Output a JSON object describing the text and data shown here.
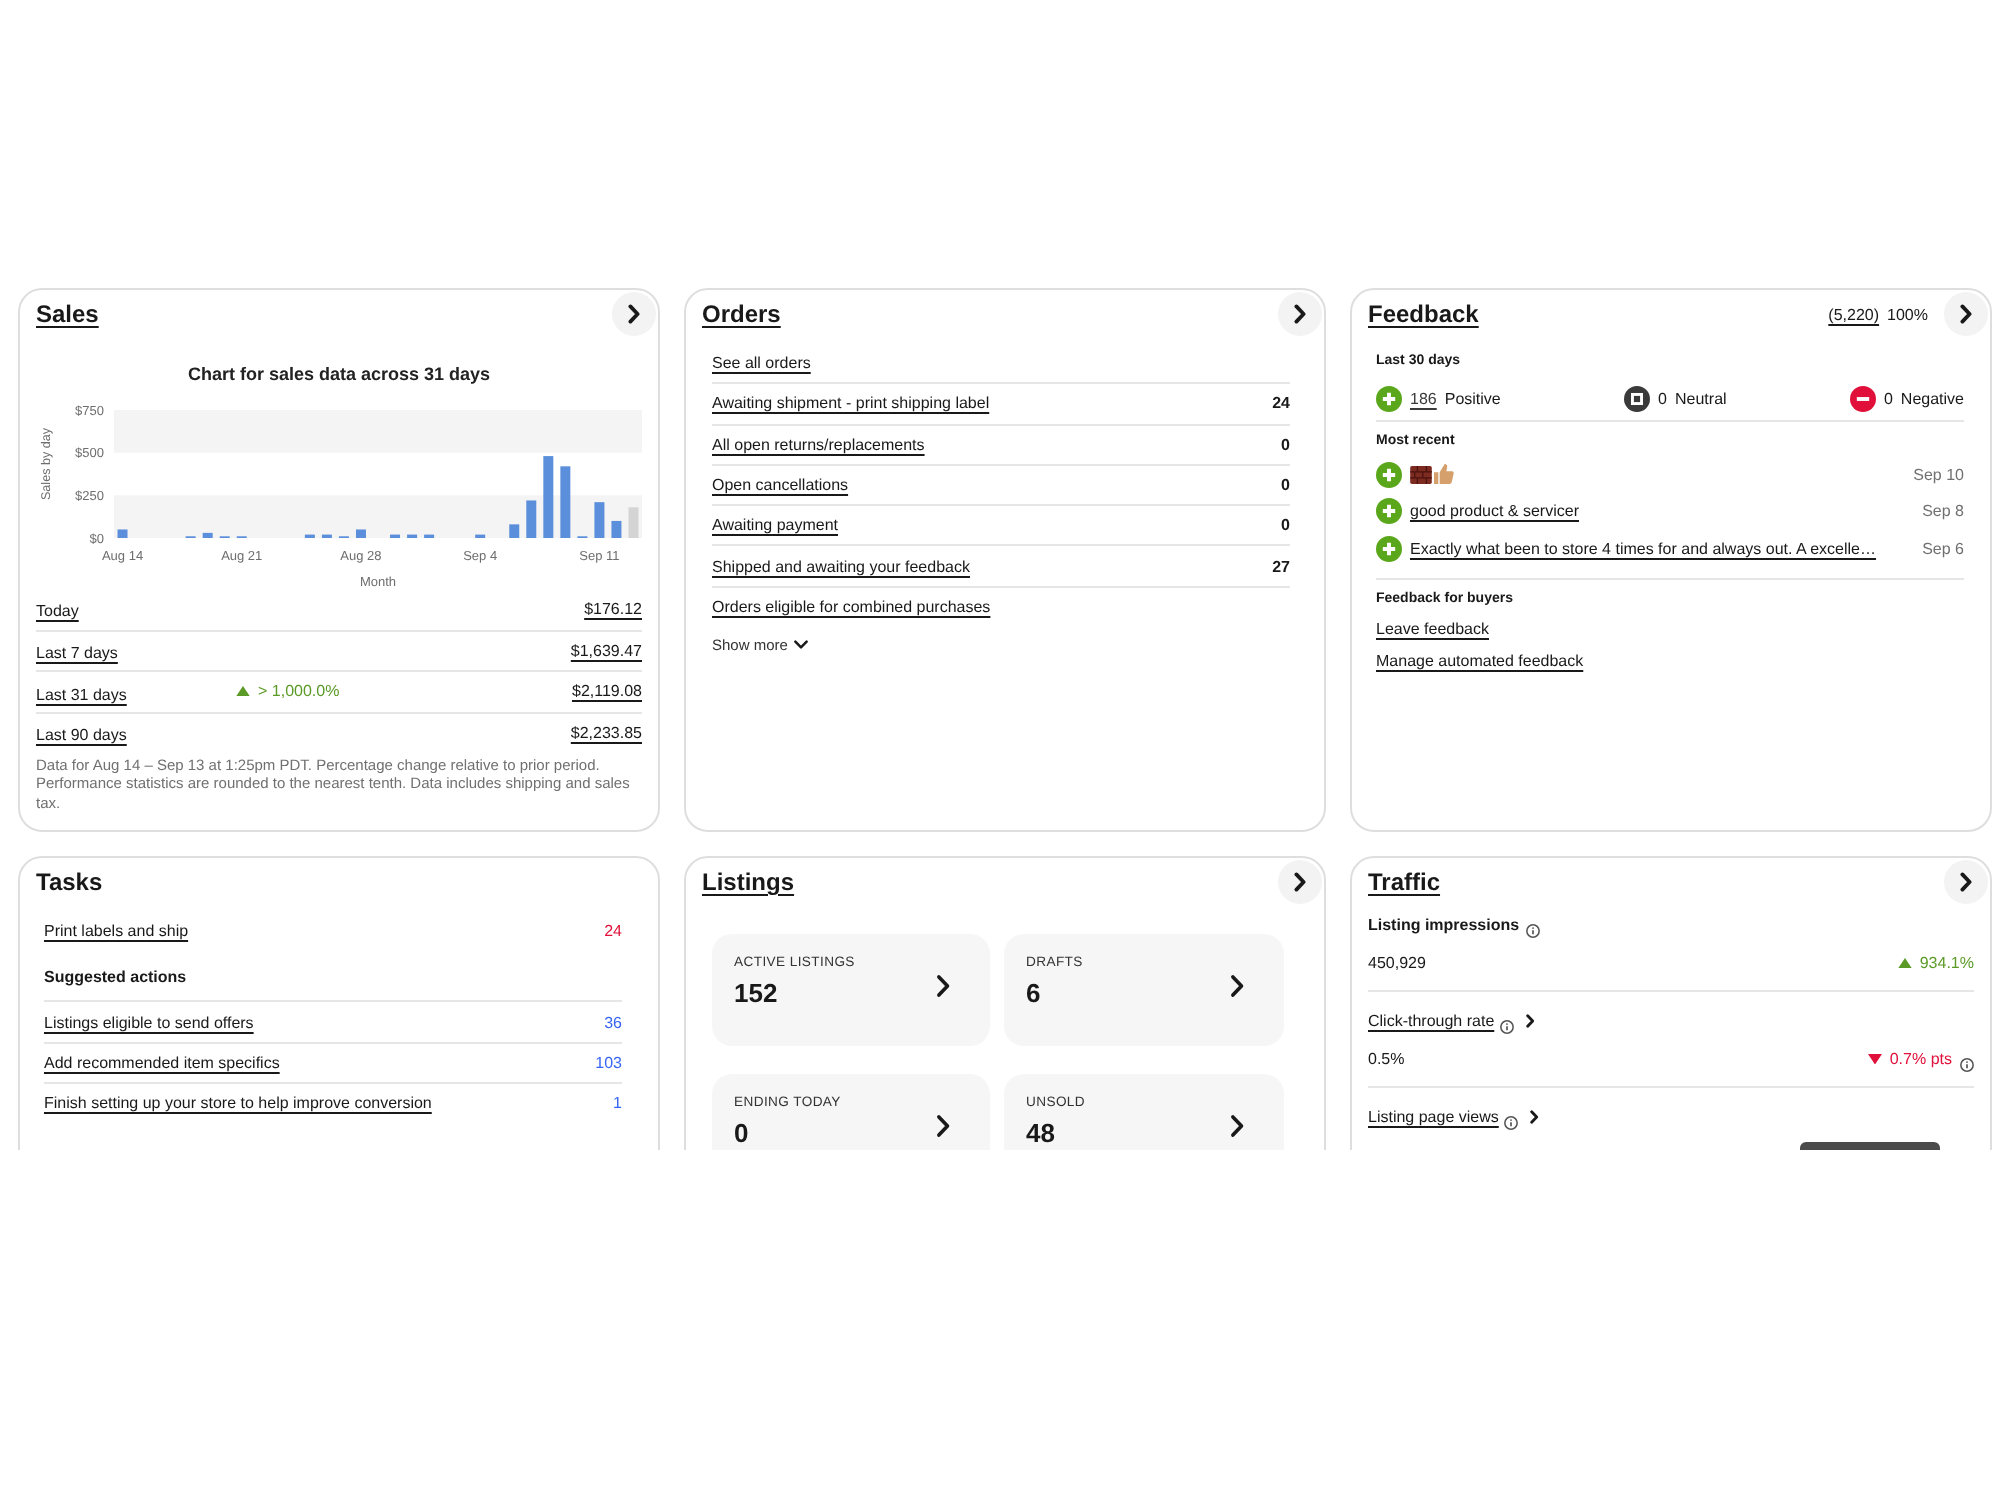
{
  "sales": {
    "title": "Sales",
    "linked": true,
    "chart_data": {
      "type": "bar",
      "title": "Chart for sales data across 31 days",
      "xlabel": "Month",
      "ylabel": "Sales by day",
      "categories": [
        "Aug 14",
        null,
        null,
        null,
        null,
        null,
        null,
        "Aug 21",
        null,
        null,
        null,
        null,
        null,
        null,
        "Aug 28",
        null,
        null,
        null,
        null,
        null,
        null,
        "Sep 4",
        null,
        null,
        null,
        null,
        null,
        null,
        "Sep 11",
        null,
        null
      ],
      "series": [
        {
          "color": "#5b8fdb",
          "values": [
            50,
            null,
            null,
            null,
            10,
            30,
            10,
            10,
            null,
            null,
            null,
            20,
            20,
            10,
            50,
            null,
            20,
            20,
            20,
            null,
            null,
            20,
            null,
            80,
            220,
            480,
            420,
            10,
            210,
            100,
            null
          ]
        },
        {
          "color": "#d4d4d4",
          "values": [
            null,
            null,
            null,
            null,
            null,
            null,
            null,
            null,
            null,
            null,
            null,
            null,
            null,
            null,
            null,
            null,
            null,
            null,
            null,
            null,
            null,
            null,
            null,
            null,
            null,
            null,
            null,
            null,
            null,
            null,
            180
          ]
        }
      ],
      "ylim": [
        0,
        750
      ],
      "yticks": [
        {
          "value": 0,
          "label": "$0"
        },
        {
          "value": 250,
          "label": "$250"
        },
        {
          "value": 500,
          "label": "$500"
        },
        {
          "value": 750,
          "label": "$750"
        }
      ]
    },
    "rows": [
      {
        "label": "Today",
        "amount": "$176.12"
      },
      {
        "label": "Last 7 days",
        "amount": "$1,639.47"
      },
      {
        "label": "Last 31 days",
        "up": true,
        "change": "> 1,000.0%",
        "amount": "$2,119.08"
      },
      {
        "label": "Last 90 days",
        "amount": "$2,233.85"
      }
    ],
    "note": "Data for Aug 14 – Sep 13 at 1:25pm PDT. Percentage change relative to prior period. Performance statistics are rounded to the nearest tenth. Data includes shipping and sales tax."
  },
  "orders": {
    "title": "Orders",
    "linked": true,
    "see_all": "See all orders",
    "rows": [
      {
        "label": "Awaiting shipment - print shipping label",
        "count": "24"
      },
      {
        "label": "All open returns/replacements",
        "count": "0"
      },
      {
        "label": "Open cancellations",
        "count": "0"
      },
      {
        "label": "Awaiting payment",
        "count": "0"
      },
      {
        "label": "Shipped and awaiting your feedback",
        "count": "27"
      },
      {
        "label": "Orders eligible for combined purchases"
      }
    ],
    "show_more": "Show more"
  },
  "feedback": {
    "title": "Feedback",
    "linked": true,
    "rating_count": "(5,220)",
    "rating_percent": "100%",
    "period": "Last 30 days",
    "summary": [
      {
        "kind": "positive",
        "count": "186",
        "label": "Positive",
        "link": true
      },
      {
        "kind": "neutral",
        "count": "0",
        "label": "Neutral",
        "link": false
      },
      {
        "kind": "negative",
        "count": "0",
        "label": "Negative",
        "link": false
      }
    ],
    "recent_heading": "Most recent",
    "recent": [
      {
        "kind": "positive",
        "emoji": true,
        "date": "Sep 10"
      },
      {
        "kind": "positive",
        "emoji": false,
        "text": "good product & servicer",
        "date": "Sep 8"
      },
      {
        "kind": "positive",
        "emoji": false,
        "text": "Exactly what been to store 4 times for and always out. A excelle…",
        "date": "Sep 6"
      }
    ],
    "buyers_heading": "Feedback for buyers",
    "buyer_links": [
      "Leave feedback",
      "Manage automated feedback"
    ]
  },
  "tasks": {
    "title": "Tasks",
    "linked": false,
    "items": [
      {
        "label": "Print labels and ship",
        "count": "24",
        "color": "#e0103a"
      }
    ],
    "suggested_heading": "Suggested actions",
    "suggested": [
      {
        "label": "Listings eligible to send offers",
        "count": "36",
        "color": "#3665f3"
      },
      {
        "label": "Add recommended item specifics",
        "count": "103",
        "color": "#3665f3"
      },
      {
        "label": "Finish setting up your store to help improve conversion",
        "count": "1",
        "color": "#3665f3"
      }
    ]
  },
  "listings": {
    "title": "Listings",
    "linked": true,
    "tiles": [
      {
        "label": "ACTIVE LISTINGS",
        "value": "152"
      },
      {
        "label": "DRAFTS",
        "value": "6"
      },
      {
        "label": "ENDING TODAY",
        "value": "0"
      },
      {
        "label": "UNSOLD",
        "value": "48"
      }
    ]
  },
  "traffic": {
    "title": "Traffic",
    "linked": true,
    "metrics": [
      {
        "label": "Listing impressions",
        "link": false,
        "value": "450,929",
        "up": true,
        "change": "934.1%",
        "change_info": false
      },
      {
        "label": "Click-through rate",
        "link": true,
        "value": "0.5%",
        "up": false,
        "change": "0.7% pts",
        "change_info": true
      },
      {
        "label": "Listing page views",
        "link": true
      }
    ],
    "popup_visible": true
  }
}
